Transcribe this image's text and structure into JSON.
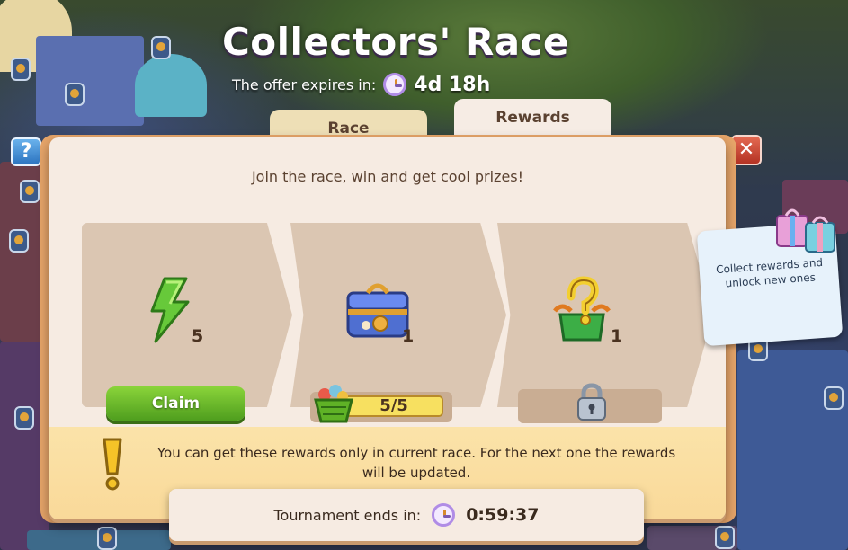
{
  "header": {
    "title": "Collectors' Race",
    "expires_label": "The offer expires in:",
    "expires_value": "4d 18h"
  },
  "tabs": [
    {
      "label": "Race",
      "active": false
    },
    {
      "label": "Rewards",
      "active": true
    }
  ],
  "panel": {
    "subtitle": "Join the race, win and get cool prizes!",
    "rewards": [
      {
        "icon": "energy-bolt-icon",
        "qty": "5",
        "action": "Claim"
      },
      {
        "icon": "chest-icon",
        "qty": "1",
        "progress_text": "5/5",
        "progress": 1.0
      },
      {
        "icon": "mystery-box-icon",
        "qty": "1",
        "locked": true
      }
    ],
    "notice": "You can get these rewards only in current race. For the next one the rewards will be updated."
  },
  "tournament": {
    "label": "Tournament ends in:",
    "time": "0:59:37"
  },
  "tooltip": {
    "text": "Collect rewards and unlock new ones"
  },
  "buttons": {
    "help": "?",
    "close": "✕"
  },
  "colors": {
    "panel": "#f6ebe2",
    "card": "#dbc6b2",
    "claim_green": "#5fb226",
    "notice": "#fbe3a9"
  }
}
